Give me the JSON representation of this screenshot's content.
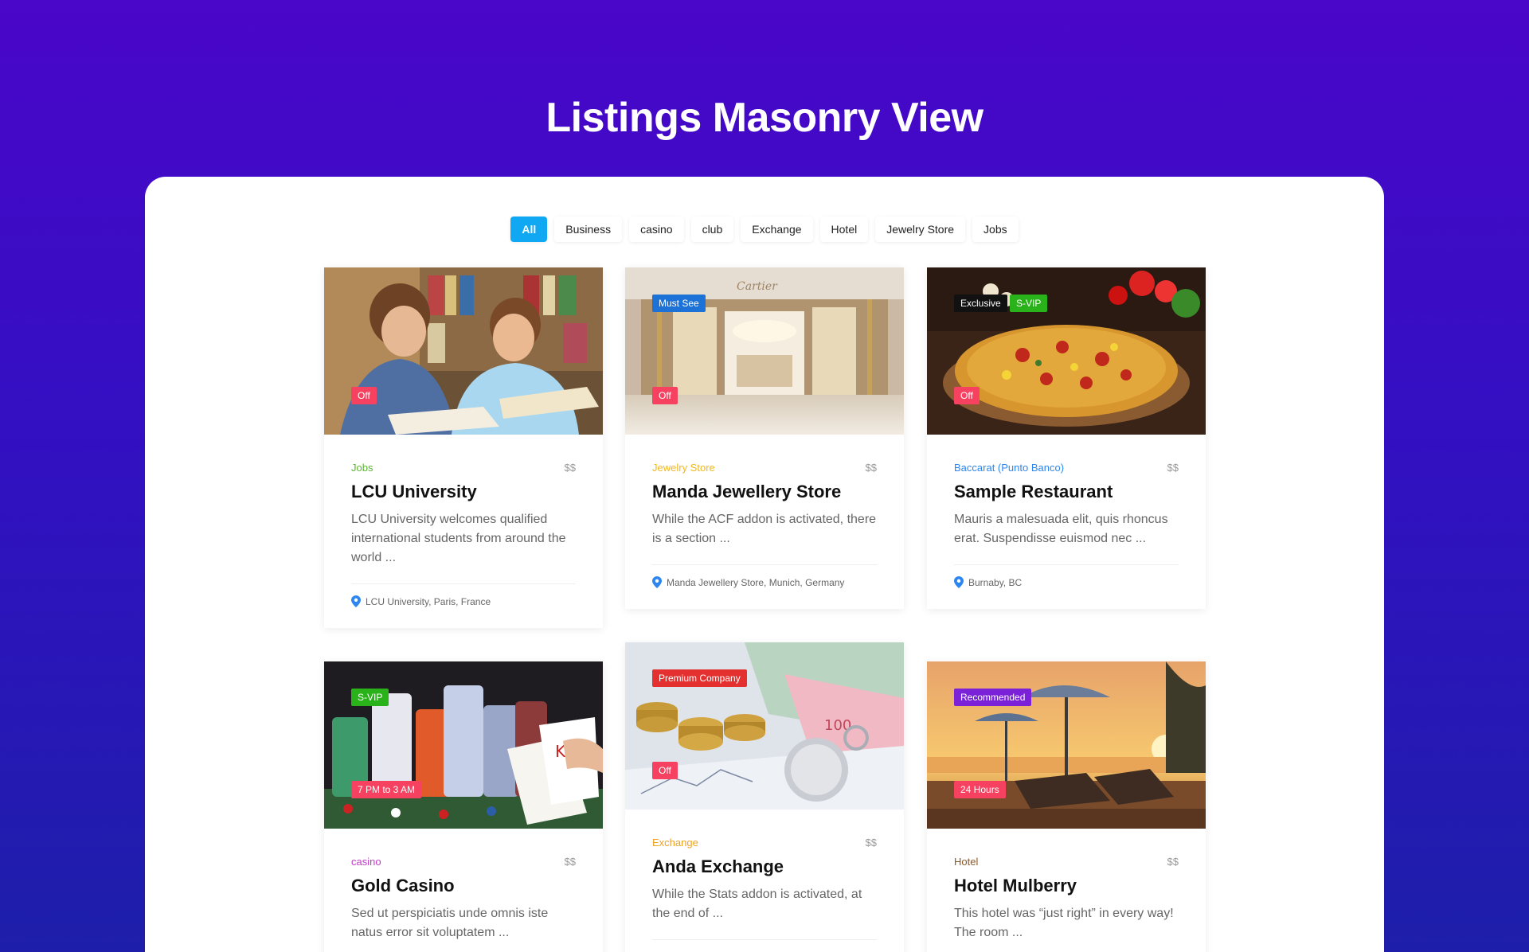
{
  "page": {
    "title": "Listings Masonry View"
  },
  "filters": [
    "All",
    "Business",
    "casino",
    "club",
    "Exchange",
    "Hotel",
    "Jewelry Store",
    "Jobs"
  ],
  "colors": {
    "accent": "#10a8f3",
    "off_badge": "#f64260",
    "pin": "#2d86f0"
  },
  "cards": [
    {
      "category": "Jobs",
      "category_color": "#5cb531",
      "price": "$$",
      "title": "LCU University",
      "desc": "LCU University welcomes qualified international students from around the world ...",
      "address": "LCU University, Paris, France",
      "badges_top": [],
      "badge_bottom": "Off"
    },
    {
      "category": "Jewelry Store",
      "category_color": "#f2b81f",
      "price": "$$",
      "title": "Manda Jewellery Store",
      "desc": "While the ACF addon is activated, there is a section ...",
      "address": "Manda Jewellery Store, Munich, Germany",
      "badges_top": [
        "Must See"
      ],
      "badge_bottom": "Off"
    },
    {
      "category": "Baccarat (Punto Banco)",
      "category_color": "#2d86f0",
      "price": "$$",
      "title": "Sample Restaurant",
      "desc": "Mauris a malesuada elit, quis rhoncus erat. Suspendisse euismod nec ...",
      "address": "Burnaby, BC",
      "badges_top": [
        "Exclusive",
        "S-VIP"
      ],
      "badge_bottom": "Off"
    },
    {
      "category": "casino",
      "category_color": "#c03cc9",
      "price": "$$",
      "title": "Gold Casino",
      "desc": "Sed ut perspiciatis unde omnis iste natus error sit voluptatem ...",
      "address": "",
      "badges_top": [
        "S-VIP"
      ],
      "badge_bottom": "7 PM to 3 AM"
    },
    {
      "category": "Exchange",
      "category_color": "#f0a21e",
      "price": "$$",
      "title": "Anda Exchange",
      "desc": "While the Stats addon is activated, at the end of ...",
      "address": "",
      "badges_top": [
        "Premium Company"
      ],
      "badge_bottom": "Off"
    },
    {
      "category": "Hotel",
      "category_color": "#8a5a2b",
      "price": "$$",
      "title": "Hotel Mulberry",
      "desc": "This hotel was “just right” in every way! The room ...",
      "address": "",
      "badges_top": [
        "Recommended"
      ],
      "badge_bottom": "24 Hours"
    }
  ]
}
